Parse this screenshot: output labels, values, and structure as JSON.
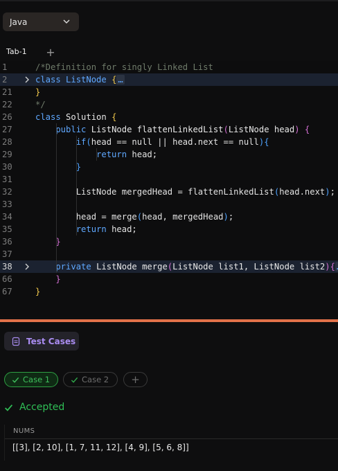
{
  "language_select": {
    "value": "Java",
    "icon": "chevron-down-icon"
  },
  "tabs": [
    {
      "label": "Tab-1"
    }
  ],
  "tab_add_icon": "+",
  "editor": {
    "lines": [
      {
        "num": "1",
        "tokens": [
          {
            "t": "/*Definition for singly Linked List",
            "c": "cm"
          }
        ]
      },
      {
        "num": "2",
        "fold": true,
        "tokens": [
          {
            "t": "class ",
            "c": "kw"
          },
          {
            "t": "ListNode ",
            "c": "kw"
          },
          {
            "t": "{",
            "c": "br1"
          },
          {
            "t": "…",
            "c": "kw"
          }
        ]
      },
      {
        "num": "21",
        "tokens": [
          {
            "t": "}",
            "c": "br1"
          }
        ]
      },
      {
        "num": "22",
        "tokens": [
          {
            "t": "*/",
            "c": "cm"
          }
        ]
      },
      {
        "num": "26",
        "tokens": [
          {
            "t": "class ",
            "c": "kw"
          },
          {
            "t": "Solution ",
            "c": "tp"
          },
          {
            "t": "{",
            "c": "br1"
          }
        ]
      },
      {
        "num": "27",
        "tokens": [
          {
            "t": "    public ",
            "c": "kw"
          },
          {
            "t": "ListNode flattenLinkedList",
            "c": "tp"
          },
          {
            "t": "(",
            "c": "br2"
          },
          {
            "t": "ListNode head",
            "c": "tp"
          },
          {
            "t": ")",
            "c": "br2"
          },
          {
            "t": " ",
            "c": "pl"
          },
          {
            "t": "{",
            "c": "br2"
          }
        ]
      },
      {
        "num": "28",
        "tokens": [
          {
            "t": "        if",
            "c": "kw"
          },
          {
            "t": "(",
            "c": "br3"
          },
          {
            "t": "head == null || head.next == null",
            "c": "pl"
          },
          {
            "t": ")",
            "c": "br3"
          },
          {
            "t": "{",
            "c": "br3"
          }
        ]
      },
      {
        "num": "29",
        "tokens": [
          {
            "t": "            return ",
            "c": "kw"
          },
          {
            "t": "head;",
            "c": "pl"
          }
        ]
      },
      {
        "num": "30",
        "tokens": [
          {
            "t": "        }",
            "c": "br3"
          }
        ]
      },
      {
        "num": "31",
        "tokens": []
      },
      {
        "num": "32",
        "tokens": [
          {
            "t": "        ListNode mergedHead = flattenLinkedList",
            "c": "pl"
          },
          {
            "t": "(",
            "c": "br3"
          },
          {
            "t": "head.next",
            "c": "pl"
          },
          {
            "t": ")",
            "c": "br3"
          },
          {
            "t": ";",
            "c": "pl"
          }
        ]
      },
      {
        "num": "33",
        "tokens": []
      },
      {
        "num": "34",
        "tokens": [
          {
            "t": "        head = merge",
            "c": "pl"
          },
          {
            "t": "(",
            "c": "br3"
          },
          {
            "t": "head, mergedHead",
            "c": "pl"
          },
          {
            "t": ")",
            "c": "br3"
          },
          {
            "t": ";",
            "c": "pl"
          }
        ]
      },
      {
        "num": "35",
        "tokens": [
          {
            "t": "        return ",
            "c": "kw"
          },
          {
            "t": "head;",
            "c": "pl"
          }
        ]
      },
      {
        "num": "36",
        "tokens": [
          {
            "t": "    }",
            "c": "br2"
          }
        ]
      },
      {
        "num": "37",
        "tokens": []
      },
      {
        "num": "38",
        "fold": true,
        "active": true,
        "tokens": [
          {
            "t": "    private ",
            "c": "kw"
          },
          {
            "t": "ListNode merge",
            "c": "tp"
          },
          {
            "t": "(",
            "c": "br2"
          },
          {
            "t": "ListNode list1, ListNode list2",
            "c": "tp"
          },
          {
            "t": ")",
            "c": "br2"
          },
          {
            "t": "{",
            "c": "br2"
          },
          {
            "t": "…",
            "c": "kw"
          }
        ]
      },
      {
        "num": "66",
        "tokens": [
          {
            "t": "    }",
            "c": "br2"
          }
        ]
      },
      {
        "num": "67",
        "tokens": [
          {
            "t": "}",
            "c": "br1"
          }
        ]
      }
    ]
  },
  "test_panel": {
    "tab_label": "Test Cases",
    "tab_icon": "test-cases-icon",
    "cases": [
      {
        "label": "Case 1",
        "selected": true
      },
      {
        "label": "Case 2",
        "selected": false
      }
    ],
    "add_case_icon": "+",
    "result": "Accepted",
    "input_name": "NUMS",
    "input_value": "[[3], [2, 10], [1, 7, 11, 12], [4, 9], [5, 6, 8]]"
  },
  "colors": {
    "divider": "#e2724a",
    "accepted": "#2fbf56",
    "keyword": "#5fa8ff",
    "tab_accent": "#a98cf0"
  }
}
